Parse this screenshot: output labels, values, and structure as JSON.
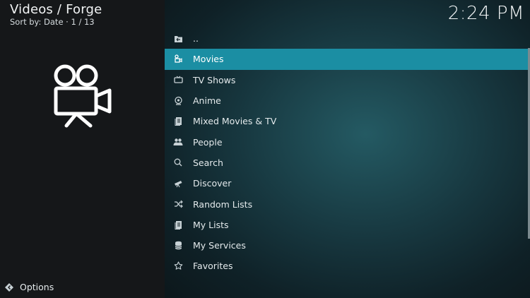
{
  "header": {
    "title": "Videos / Forge",
    "subtitle": "Sort by: Date  ·  1 / 13"
  },
  "clock": "2:24 PM",
  "list": {
    "items": [
      {
        "label": "..",
        "icon": "folder-back-icon"
      },
      {
        "label": "Movies",
        "icon": "film-icon",
        "selected": true
      },
      {
        "label": "TV Shows",
        "icon": "tv-icon"
      },
      {
        "label": "Anime",
        "icon": "anime-icon"
      },
      {
        "label": "Mixed Movies & TV",
        "icon": "stack-icon"
      },
      {
        "label": "People",
        "icon": "people-icon"
      },
      {
        "label": "Search",
        "icon": "search-icon"
      },
      {
        "label": "Discover",
        "icon": "telescope-icon"
      },
      {
        "label": "Random Lists",
        "icon": "shuffle-icon"
      },
      {
        "label": "My Lists",
        "icon": "list-icon"
      },
      {
        "label": "My Services",
        "icon": "database-icon"
      },
      {
        "label": "Favorites",
        "icon": "star-icon"
      }
    ]
  },
  "footer": {
    "options_label": "Options"
  },
  "colors": {
    "accent": "#1b8ea3"
  }
}
